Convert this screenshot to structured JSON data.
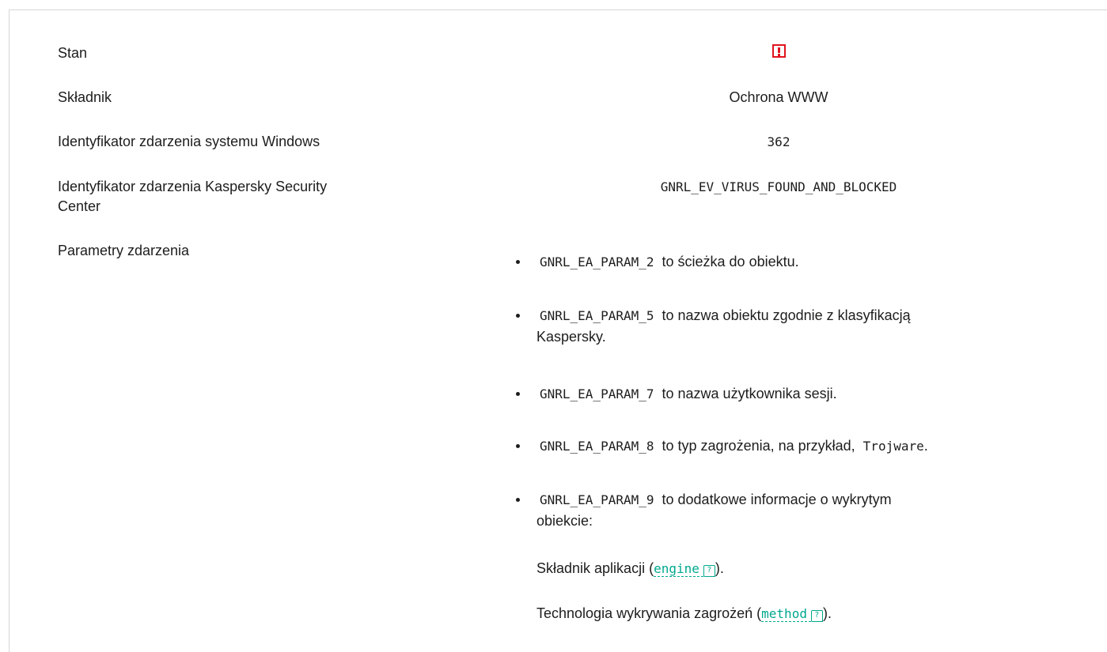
{
  "rows": {
    "status": {
      "label": "Stan",
      "icon": "warning-exclamation-icon",
      "icon_color": "#e0141e"
    },
    "component": {
      "label": "Składnik",
      "value": "Ochrona WWW"
    },
    "windows_event_id": {
      "label": "Identyfikator zdarzenia systemu Windows",
      "value": "362"
    },
    "ksc_event_id": {
      "label_line1": "Identyfikator zdarzenia Kaspersky Security",
      "label_line2": "Center",
      "value": "GNRL_EV_VIRUS_FOUND_AND_BLOCKED"
    },
    "event_params": {
      "label": "Parametry zdarzenia"
    }
  },
  "params": [
    {
      "code": "GNRL_EA_PARAM_2",
      "text": "to ścieżka do obiektu."
    },
    {
      "code": "GNRL_EA_PARAM_5",
      "text": "to nazwa obiektu zgodnie z klasyfikacją",
      "text2": "Kaspersky."
    },
    {
      "code": "GNRL_EA_PARAM_7",
      "text": "to nazwa użytkownika sesji."
    },
    {
      "code": "GNRL_EA_PARAM_8",
      "text": "to typ zagrożenia, na przykład,",
      "example": "Trojware",
      "suffix": "."
    },
    {
      "code": "GNRL_EA_PARAM_9",
      "text": "to dodatkowe informacje o wykrytym",
      "text2": "obiekcie:"
    }
  ],
  "sub_items": [
    {
      "prefix": "Składnik aplikacji (",
      "link": "engine",
      "suffix": ")."
    },
    {
      "prefix": "Technologia wykrywania zagrożeń (",
      "link": "method",
      "suffix": ")."
    }
  ],
  "help_glyph": "?",
  "link_color": "#00a88e"
}
